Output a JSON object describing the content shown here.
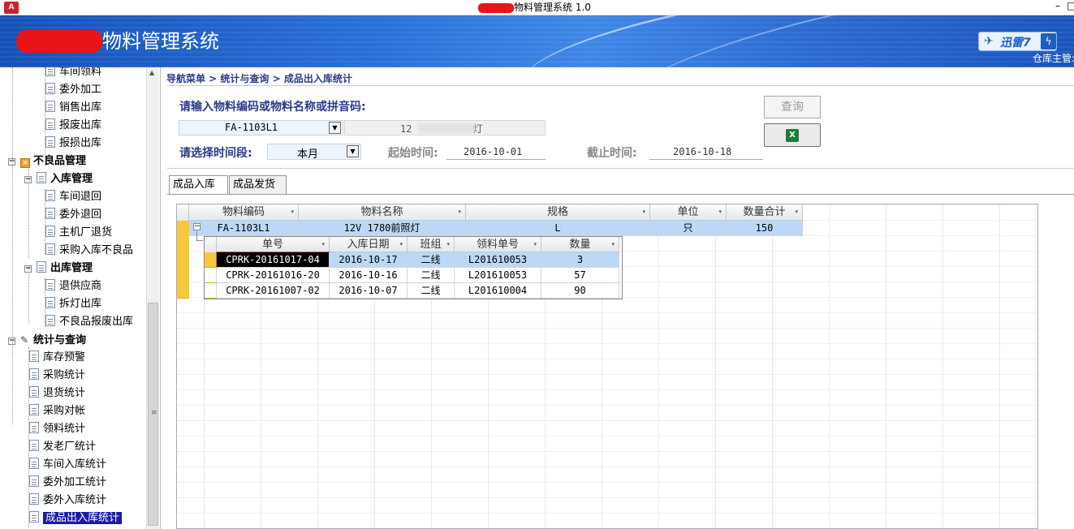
{
  "window": {
    "title": "物料管理系统 1.0",
    "app_icon": "A",
    "minimize": "–",
    "maximize": "□"
  },
  "banner": {
    "title": "物料管理系统",
    "xunlei_label": "迅雷7",
    "xunlei_bolt": "ϟ",
    "warehouse_label": "仓库主管:"
  },
  "sidebar": {
    "items": [
      {
        "label": "车间领料",
        "level": 3
      },
      {
        "label": "委外加工",
        "level": 3
      },
      {
        "label": "销售出库",
        "level": 3
      },
      {
        "label": "报废出库",
        "level": 3
      },
      {
        "label": "报损出库",
        "level": 3
      },
      {
        "label": "不良品管理",
        "level": 1
      },
      {
        "label": "入库管理",
        "level": 2
      },
      {
        "label": "车间退回",
        "level": 3
      },
      {
        "label": "委外退回",
        "level": 3
      },
      {
        "label": "主机厂退货",
        "level": 3
      },
      {
        "label": "采购入库不良品",
        "level": 3
      },
      {
        "label": "出库管理",
        "level": 2
      },
      {
        "label": "退供应商",
        "level": 3
      },
      {
        "label": "拆灯出库",
        "level": 3
      },
      {
        "label": "不良品报废出库",
        "level": 3
      },
      {
        "label": "统计与查询",
        "level": 1
      },
      {
        "label": "库存预警",
        "level": 2
      },
      {
        "label": "采购统计",
        "level": 2
      },
      {
        "label": "退货统计",
        "level": 2
      },
      {
        "label": "采购对帐",
        "level": 2
      },
      {
        "label": "领料统计",
        "level": 2
      },
      {
        "label": "发老厂统计",
        "level": 2
      },
      {
        "label": "车间入库统计",
        "level": 2
      },
      {
        "label": "委外加工统计",
        "level": 2
      },
      {
        "label": "委外入库统计",
        "level": 2
      },
      {
        "label": "成品出入库统计",
        "level": 2,
        "selected": true
      }
    ],
    "expand_minus": "−"
  },
  "main": {
    "breadcrumb": "导航菜单 > 统计与查询 > 成品出入库统计",
    "material_label": "请输入物料编码或物料名称或拼音码:",
    "material_code": "FA-1103L1",
    "material_name": "12",
    "material_name_tail": "灯",
    "period_label": "请选择时间段:",
    "period_value": "本月",
    "start_label": "起始时间:",
    "start_date": "2016-10-01",
    "end_label": "截止时间:",
    "end_date": "2016-10-18",
    "query_button": "查询",
    "excel_icon": "X",
    "dd_arrow": "▼"
  },
  "tabs": [
    {
      "label": "成品入库",
      "active": true
    },
    {
      "label": "成品发货",
      "active": false
    }
  ],
  "grid": {
    "columns": [
      "物料编码",
      "物料名称",
      "规格",
      "单位",
      "数量合计"
    ],
    "master": {
      "code": "FA-1103L1",
      "name": "12V 1780前照灯",
      "spec": "L",
      "unit": "只",
      "total": "150"
    },
    "sub_columns": [
      "单号",
      "入库日期",
      "班组",
      "领料单号",
      "数量"
    ],
    "sub_rows": [
      [
        "CPRK-20161017-04",
        "2016-10-17",
        "二线",
        "L201610053",
        "3"
      ],
      [
        "CPRK-20161016-20",
        "2016-10-16",
        "二线",
        "L201610053",
        "57"
      ],
      [
        "CPRK-20161007-02",
        "2016-10-07",
        "二线",
        "L201610004",
        "90"
      ]
    ],
    "toggle": "−",
    "sort_arrow": "▾"
  }
}
